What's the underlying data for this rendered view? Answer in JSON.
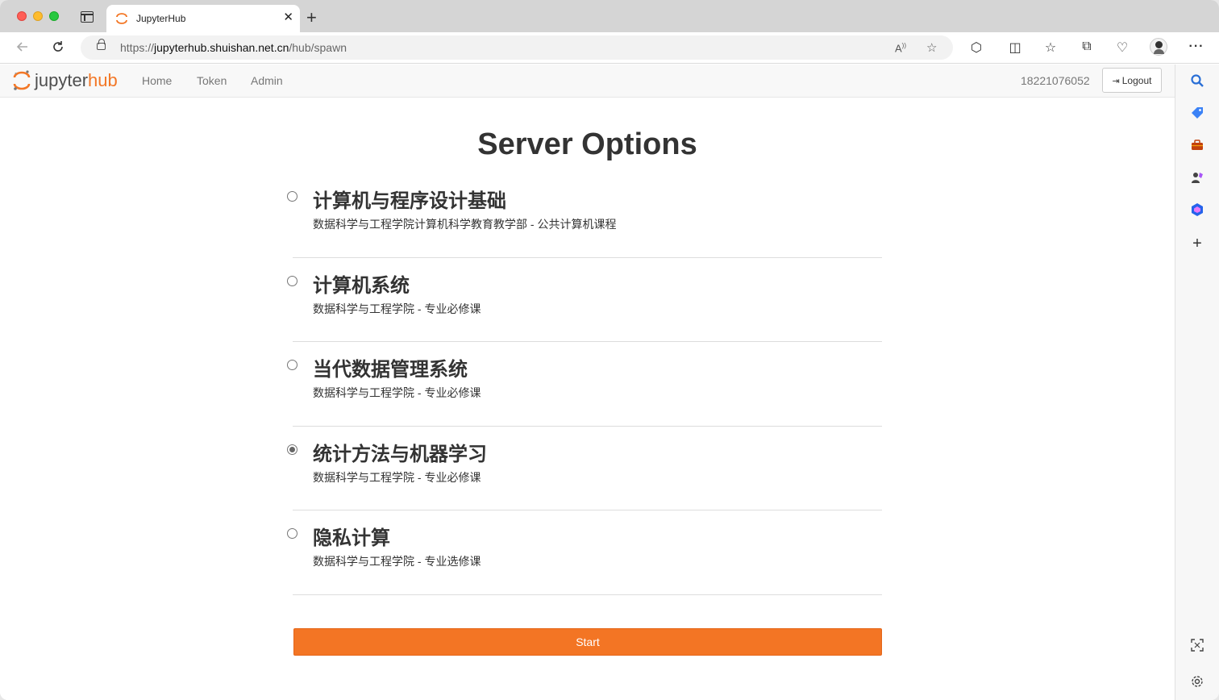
{
  "browser": {
    "tab_title": "JupyterHub",
    "url_prefix": "https://",
    "url_host": "jupyterhub.shuishan.net.cn",
    "url_path": "/hub/spawn",
    "close_glyph": "✕",
    "new_tab_glyph": "+"
  },
  "navbar": {
    "logo_jupyter": "jupyter",
    "logo_hub": "hub",
    "links": [
      "Home",
      "Token",
      "Admin"
    ],
    "user": "18221076052",
    "logout_label": "Logout"
  },
  "page": {
    "heading": "Server Options",
    "options": [
      {
        "title": "计算机与程序设计基础",
        "description": "数据科学与工程学院计算机科学教育教学部 - 公共计算机课程",
        "checked": false
      },
      {
        "title": "计算机系统",
        "description": "数据科学与工程学院 - 专业必修课",
        "checked": false
      },
      {
        "title": "当代数据管理系统",
        "description": "数据科学与工程学院 - 专业必修课",
        "checked": false
      },
      {
        "title": "统计方法与机器学习",
        "description": "数据科学与工程学院 - 专业必修课",
        "checked": true
      },
      {
        "title": "隐私计算",
        "description": "数据科学与工程学院 - 专业选修课",
        "checked": false
      }
    ],
    "start_label": "Start"
  },
  "colors": {
    "accent": "#f37524",
    "brand_orange": "#f37726"
  },
  "icons": {
    "toolbar": [
      "back-icon",
      "reload-icon",
      "lock-icon",
      "read-aloud-icon",
      "favorite-star-icon",
      "extensions-icon",
      "split-screen-icon",
      "favorites-icon",
      "collections-icon",
      "browser-essentials-icon",
      "profile-avatar-icon",
      "more-icon"
    ],
    "sidebar": [
      "search-icon",
      "shopping-tag-icon",
      "tools-icon",
      "games-icon",
      "office-icon",
      "add-icon",
      "screenshot-icon",
      "settings-icon"
    ]
  }
}
